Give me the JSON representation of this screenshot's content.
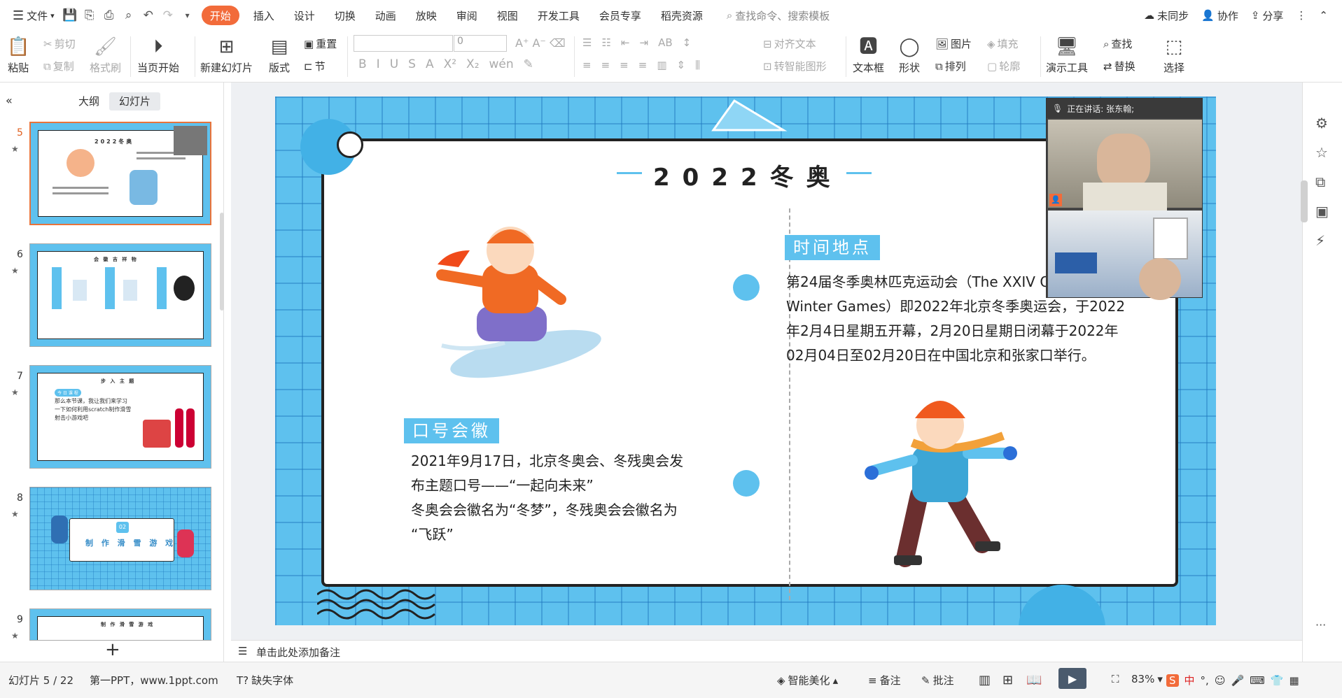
{
  "menubar": {
    "file": "文件",
    "tabs": [
      "开始",
      "插入",
      "设计",
      "切换",
      "动画",
      "放映",
      "审阅",
      "视图",
      "开发工具",
      "会员专享",
      "稻壳资源"
    ],
    "search": "查找命令、搜索模板",
    "sync": "未同步",
    "collab": "协作",
    "share": "分享"
  },
  "ribbon": {
    "paste": "粘贴",
    "cut": "剪切",
    "copy": "复制",
    "format_painter": "格式刷",
    "play_current": "当页开始",
    "new_slide": "新建幻灯片",
    "layout": "版式",
    "reset": "重置",
    "section": "节",
    "font_size": "0",
    "align_text": "对齐文本",
    "smart_art": "转智能图形",
    "textbox": "文本框",
    "shape": "形状",
    "picture": "图片",
    "fill": "填充",
    "arrange": "排列",
    "outline": "轮廓",
    "presentation_tools": "演示工具",
    "find": "查找",
    "replace": "替换",
    "select": "选择"
  },
  "leftpanel": {
    "tab_outline": "大纲",
    "tab_slides": "幻灯片",
    "slides": [
      {
        "num": "5"
      },
      {
        "num": "6"
      },
      {
        "num": "7"
      },
      {
        "num": "8"
      },
      {
        "num": "9"
      }
    ],
    "thumb6": {
      "title": "会 徽 吉 祥 物"
    },
    "thumb7": {
      "title": "步 入 主 题",
      "tag": "今 日 课 程",
      "text1": "那么本节课，我让我们来学习",
      "text2": "一下如何利用scratch制作滑雪",
      "text3": "射击小游戏吧"
    },
    "thumb8": {
      "num": "02",
      "title": "制 作 滑 雪 游 戏"
    },
    "thumb9": {
      "title": "制 作 滑 雪 游 戏"
    }
  },
  "slide": {
    "title": "2022冬奥",
    "tag_time": "时间地点",
    "time_text": "第24届冬季奥林匹克运动会（The XXIV Olympic Winter Games）即2022年北京冬季奥运会，于2022年2月4日星期五开幕，2月20日星期日闭幕于2022年02月04日至02月20日在中国北京和张家口举行。",
    "tag_slogan": "口号会徽",
    "slogan_line1": "2021年9月17日，北京冬奥会、冬残奥会发",
    "slogan_line2": "布主题口号——“一起向未来”",
    "slogan_line3": "冬奥会会徽名为“冬梦”，冬残奥会会徽名为",
    "slogan_line4": "“飞跃”"
  },
  "video": {
    "speaking": "正在讲话: 张东翰;"
  },
  "notes": {
    "placeholder": "单击此处添加备注"
  },
  "status": {
    "slide_count": "幻灯片 5 / 22",
    "theme": "第一PPT，www.1ppt.com",
    "missing_font": "缺失字体",
    "beautify": "智能美化",
    "notes": "备注",
    "comments": "批注",
    "zoom": "83%"
  }
}
